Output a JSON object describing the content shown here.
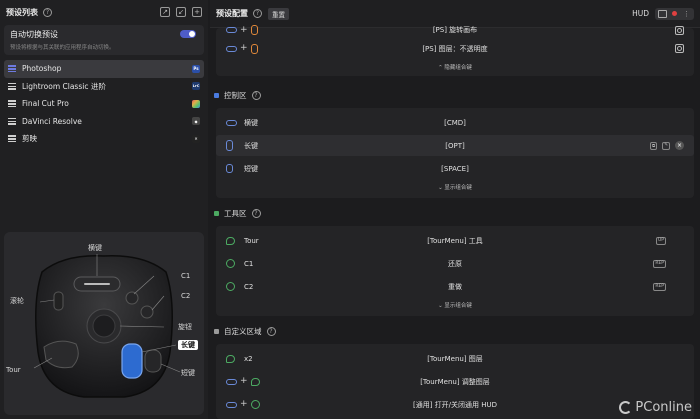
{
  "left": {
    "title": "预设列表",
    "auto_switch": {
      "label": "自动切换预设",
      "desc": "预设将根据与其关联的应用程序自动切换。"
    },
    "apps": [
      {
        "name": "Photoshop",
        "badge": "Ps",
        "badge_color": "#3b6fd6",
        "selected": true
      },
      {
        "name": "Lightroom Classic 进阶",
        "badge": "LrC",
        "badge_color": "#3b6fd6",
        "selected": false
      },
      {
        "name": "Final Cut Pro",
        "badge": "",
        "badge_color": "#d6a23b",
        "selected": false
      },
      {
        "name": "DaVinci Resolve",
        "badge": "",
        "badge_color": "#555555",
        "selected": false
      },
      {
        "name": "剪映",
        "badge": "",
        "badge_color": "#333333",
        "selected": false
      }
    ],
    "device_labels": {
      "horizontal": "横键",
      "c1": "C1",
      "c2": "C2",
      "scroll": "滚轮",
      "knob": "旋钮",
      "long": "长键",
      "tour": "Tour",
      "short": "短键"
    }
  },
  "right": {
    "title": "预设配置",
    "reset": "重置",
    "hud": "HUD",
    "top_card": {
      "rows": [
        {
          "value": "[PS] 旋转画布"
        },
        {
          "value": "[PS] 图层：不透明度"
        }
      ],
      "more": "隐藏组合键"
    },
    "control": {
      "title": "控制区",
      "rows": [
        {
          "name": "横键",
          "value": "[CMD]"
        },
        {
          "name": "长键",
          "value": "[OPT]"
        },
        {
          "name": "短键",
          "value": "[SPACE]"
        }
      ],
      "more": "显示组合键"
    },
    "tool": {
      "title": "工具区",
      "rows": [
        {
          "name": "Tour",
          "value": "[TourMenu] 工具",
          "tag": "UP"
        },
        {
          "name": "C1",
          "value": "还原",
          "tag": "REP"
        },
        {
          "name": "C2",
          "value": "重做",
          "tag": "REP"
        }
      ],
      "more": "显示组合键"
    },
    "custom": {
      "title": "自定义区域",
      "rows": [
        {
          "name": "x2",
          "value": "[TourMenu] 图层"
        },
        {
          "name": "",
          "value": "[TourMenu] 调整图层"
        },
        {
          "name": "",
          "value": "[通用] 打开/关闭通用 HUD"
        }
      ]
    },
    "colors": {
      "control": "#4a7be0",
      "tool": "#4caa62",
      "custom": "#9a9a9a"
    }
  },
  "watermark": "PConline"
}
